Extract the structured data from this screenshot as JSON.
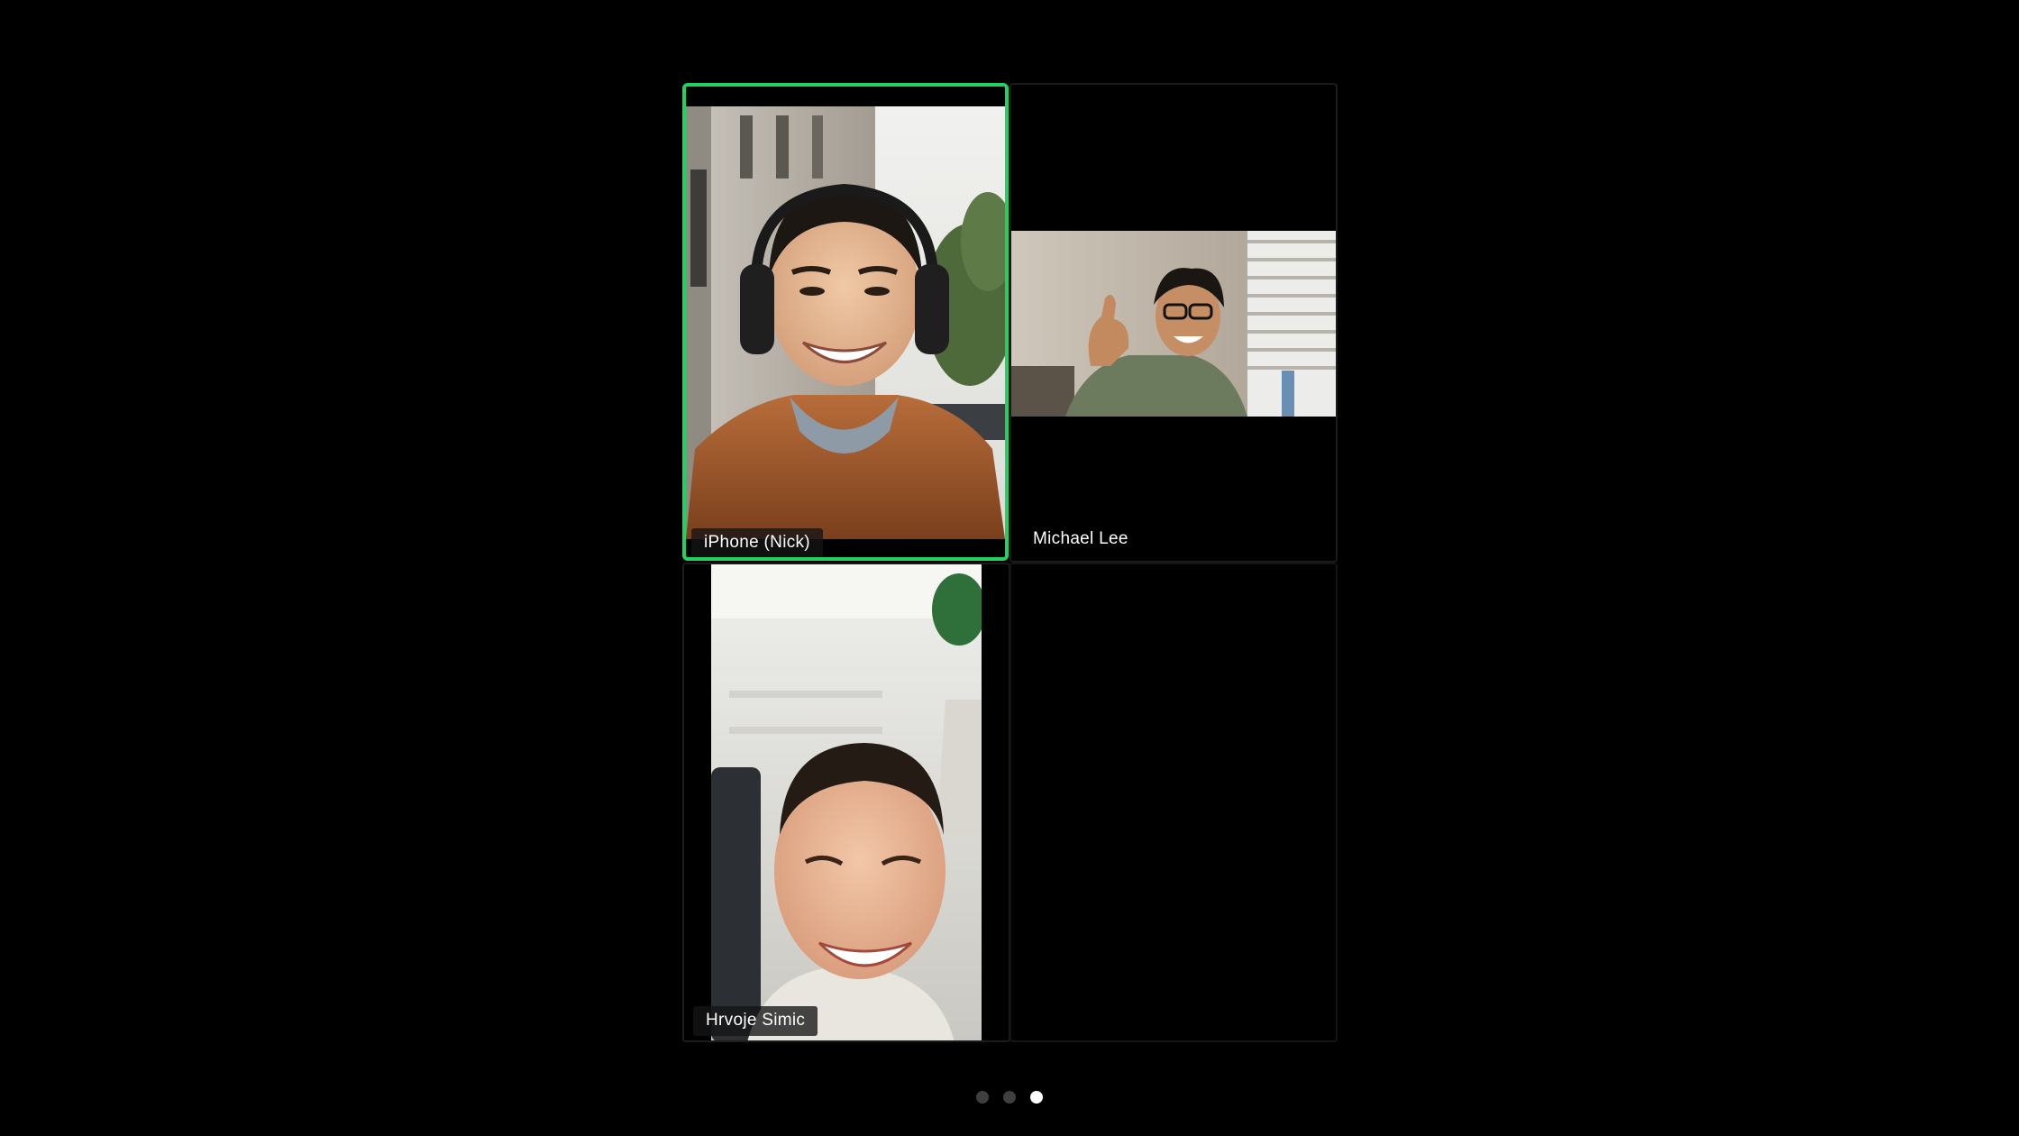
{
  "participants": [
    {
      "name": "iPhone (Nick)",
      "active_speaker": true
    },
    {
      "name": "Michael Lee",
      "active_speaker": false
    },
    {
      "name": "Hrvoje Simic",
      "active_speaker": false
    }
  ],
  "pagination": {
    "total_pages": 3,
    "current_page": 3
  },
  "colors": {
    "background": "#000000",
    "active_speaker_border": "#23d160",
    "page_dot_active": "#ffffff",
    "page_dot_inactive": "#3f3f3f"
  }
}
